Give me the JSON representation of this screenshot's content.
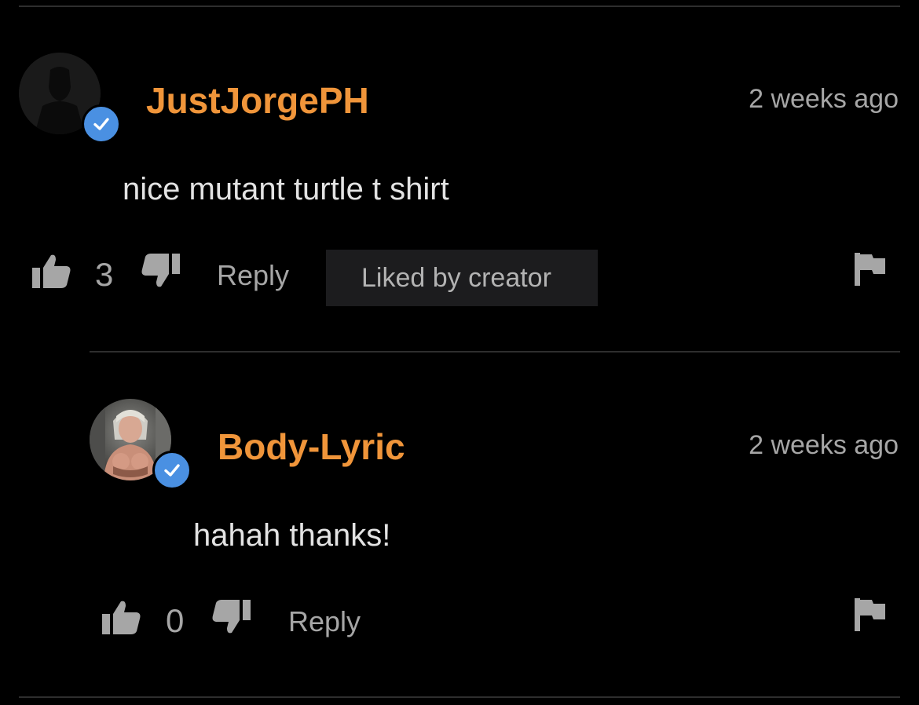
{
  "colors": {
    "background": "#000000",
    "username": "#f0953a",
    "muted_text": "#a6a6a6",
    "comment_text": "#e3e3e3",
    "verified_badge": "#4a90e2",
    "divider": "#2e2e2e",
    "liked_badge_bg": "#1c1c1e"
  },
  "comments": [
    {
      "username": "JustJorgePH",
      "timestamp": "2 weeks ago",
      "text": "nice mutant turtle t shirt",
      "likes": "3",
      "reply_label": "Reply",
      "badge": "Liked by creator",
      "avatar_icon": "default-user-silhouette",
      "verified": true
    },
    {
      "username": "Body-Lyric",
      "timestamp": "2 weeks ago",
      "text": "hahah thanks!",
      "likes": "0",
      "reply_label": "Reply",
      "avatar_icon": "user-photo",
      "verified": true
    }
  ],
  "icons": {
    "like": "thumbs-up-icon",
    "dislike": "thumbs-down-icon",
    "flag": "flag-icon",
    "verified": "checkmark-icon"
  }
}
